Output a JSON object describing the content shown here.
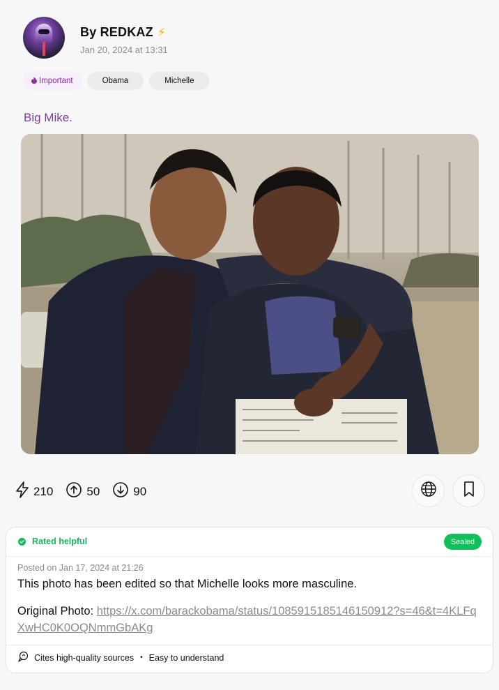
{
  "post": {
    "author": "By REDKAZ",
    "verified_icon": "lightning-bolt-icon",
    "date": "Jan 20, 2024 at 13:31",
    "tags": [
      {
        "label": "Important",
        "icon": "flame-icon"
      },
      {
        "label": "Obama"
      },
      {
        "label": "Michelle"
      }
    ],
    "text": "Big Mike."
  },
  "stats": {
    "boosts": "210",
    "upvotes": "50",
    "downvotes": "90"
  },
  "note": {
    "status": "Rated helpful",
    "badge": "Sealed",
    "posted": "Posted on Jan 17, 2024 at 21:26",
    "text": "This photo has been edited so that Michelle looks more masculine.",
    "original_label": "Original Photo:",
    "original_url": "https://x.com/barackobama/status/1085915185146150912?s=46&t=4KLFqXwHC0K0OQNmmGbAKg",
    "reasons": [
      "Cites high-quality sources",
      "Easy to understand"
    ]
  },
  "colors": {
    "accent": "#7b3d9c",
    "helpful": "#14b85a",
    "sealed": "#11c05a"
  }
}
